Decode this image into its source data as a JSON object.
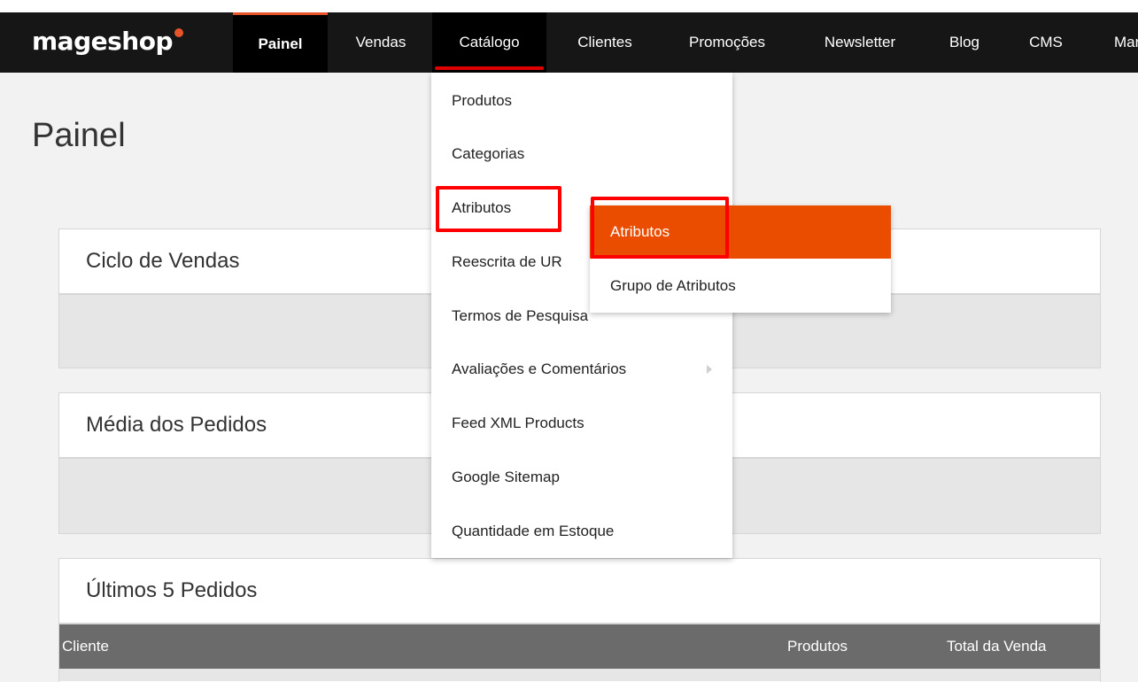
{
  "logo": {
    "text": "mageshop"
  },
  "nav": {
    "items": [
      {
        "label": "Painel"
      },
      {
        "label": "Vendas"
      },
      {
        "label": "Catálogo"
      },
      {
        "label": "Clientes"
      },
      {
        "label": "Promoções"
      },
      {
        "label": "Newsletter"
      },
      {
        "label": "Blog"
      },
      {
        "label": "CMS"
      },
      {
        "label": "Mar"
      }
    ],
    "active": "Painel",
    "open": "Catálogo"
  },
  "page": {
    "title": "Painel"
  },
  "panels": {
    "sales_cycle": {
      "title": "Ciclo de Vendas"
    },
    "average_orders": {
      "title": "Média dos Pedidos"
    },
    "last_orders": {
      "title": "Últimos 5 Pedidos",
      "columns": [
        "Cliente",
        "Produtos",
        "Total da Venda"
      ]
    }
  },
  "catalog_menu": {
    "items": [
      {
        "label": "Produtos"
      },
      {
        "label": "Categorias"
      },
      {
        "label": "Atributos"
      },
      {
        "label": "Reescrita de UR"
      },
      {
        "label": "Termos de Pesquisa"
      },
      {
        "label": "Avaliações e Comentários"
      },
      {
        "label": "Feed XML Products"
      },
      {
        "label": "Google Sitemap"
      },
      {
        "label": "Quantidade em Estoque"
      }
    ]
  },
  "attributes_submenu": {
    "items": [
      {
        "label": "Atributos"
      },
      {
        "label": "Grupo de Atributos"
      }
    ],
    "selected": "Atributos"
  },
  "colors": {
    "navbar": "#161616",
    "accent": "#eb4d00",
    "annotation": "#ff0000",
    "table_header": "#6b6b6b"
  }
}
